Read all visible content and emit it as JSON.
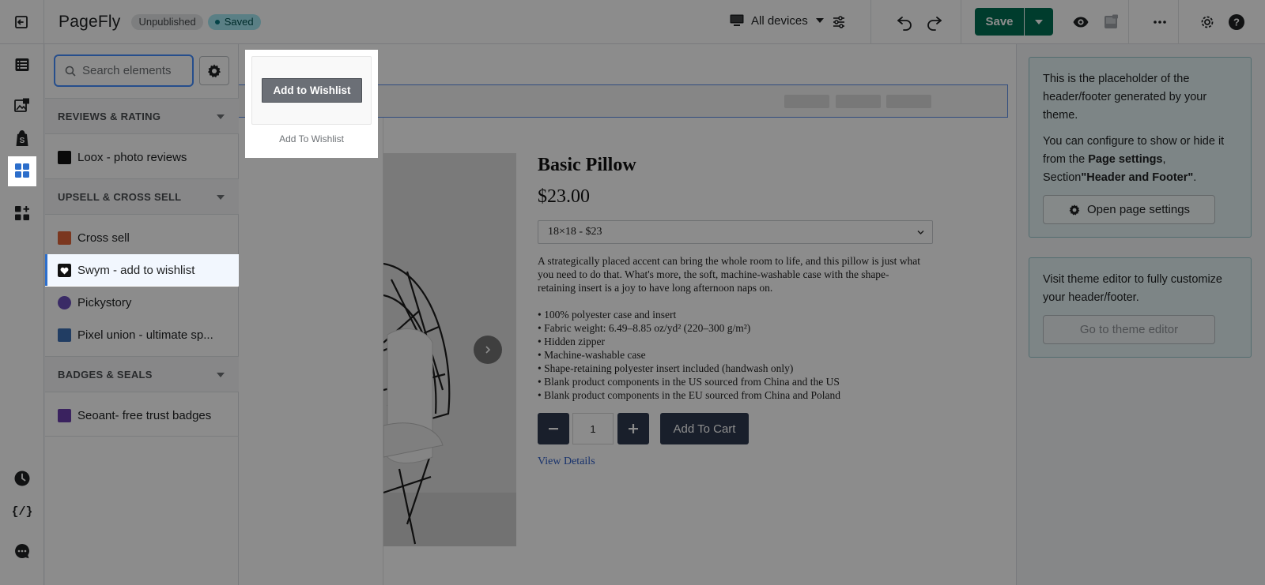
{
  "topbar": {
    "app_name": "PageFly",
    "status_unpublished": "Unpublished",
    "status_saved": "Saved",
    "devices_label": "All devices",
    "save_label": "Save"
  },
  "panel": {
    "search_placeholder": "Search elements",
    "sections": [
      {
        "title": "REVIEWS & RATING",
        "items": [
          "Loox - photo reviews"
        ]
      },
      {
        "title": "UPSELL & CROSS SELL",
        "items": [
          "Cross sell",
          "Swym - add to wishlist",
          "Pickystory",
          "Pixel union - ultimate sp..."
        ]
      },
      {
        "title": "BADGES & SEALS",
        "items": [
          "Seoant- free trust badges"
        ]
      }
    ],
    "selected_item": "Swym - add to wishlist"
  },
  "drag_preview": {
    "button_label": "Add to Wishlist",
    "caption": "Add To Wishlist"
  },
  "product": {
    "title": "Basic Pillow",
    "price": "$23.00",
    "variant": "18×18 - $23",
    "description": "A strategically placed accent can bring the whole room to life, and this pillow is just what you need to do that. What's more, the soft, machine-washable case with the shape-retaining insert is a joy to have long afternoon naps on.",
    "bullets": [
      "• 100% polyester case and insert",
      "• Fabric weight: 6.49–8.85 oz/yd² (220–300 g/m²)",
      "• Hidden zipper",
      "• Machine-washable case",
      "• Shape-retaining polyester insert included (handwash only)",
      "• Blank product components in the US sourced from China and the US",
      "• Blank product components in the EU sourced from China and Poland"
    ],
    "quantity": "1",
    "add_to_cart": "Add To Cart",
    "view_details": "View Details"
  },
  "right_panel": {
    "box1_text1": "This is the placeholder of the header/footer generated by your theme.",
    "box1_text2_pre": "You can configure to show or hide it from the ",
    "box1_text2_bold1": "Page settings",
    "box1_text2_mid": ", Section",
    "box1_text2_bold2": "\"Header and Footer\"",
    "box1_text2_post": ".",
    "box1_button": "Open page settings",
    "box2_text": "Visit theme editor to fully customize your header/footer.",
    "box2_button": "Go to theme editor"
  },
  "icons": {
    "exit": "exit-icon",
    "devices": "desktop-icon",
    "sliders": "sliders-icon",
    "undo": "undo-icon",
    "redo": "redo-icon",
    "preview": "eye-icon",
    "more": "more-icon",
    "settings": "gear-icon",
    "help": "help-icon"
  },
  "colors": {
    "save": "#006e52",
    "accent_blue": "#2c6ecb",
    "info_bg": "#e4f3f4"
  }
}
